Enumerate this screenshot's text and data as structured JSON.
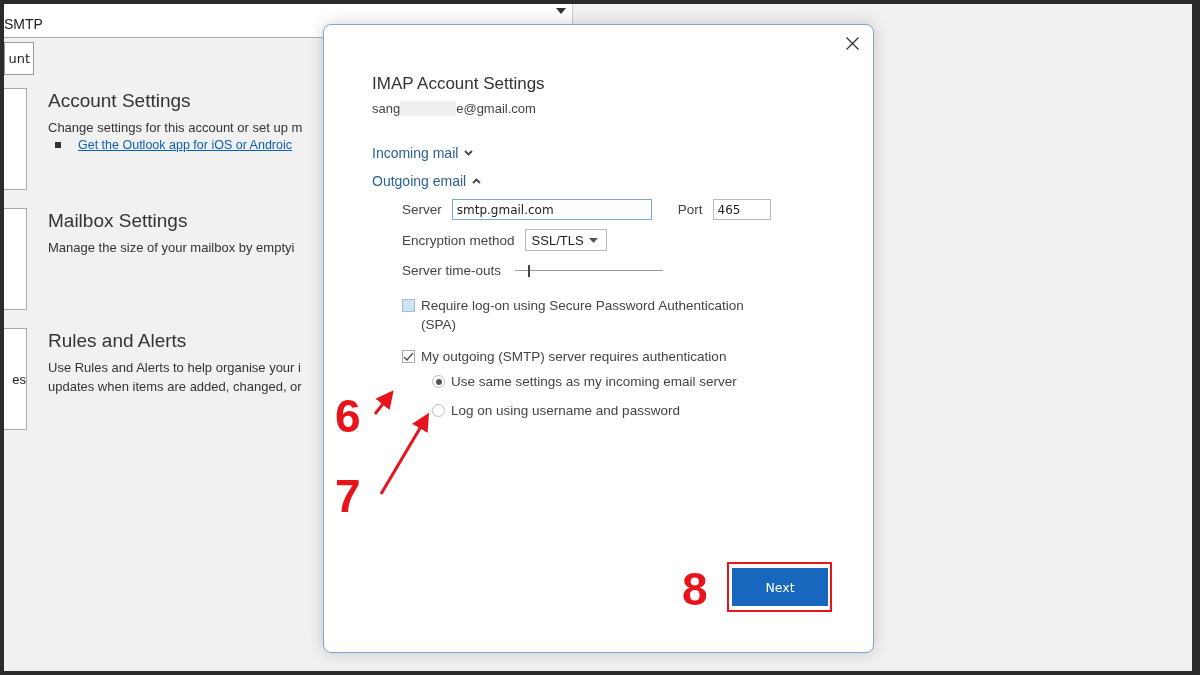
{
  "background": {
    "account_type": "SMTP",
    "button": "unt",
    "sections": [
      {
        "title": "Account Settings",
        "description": "Change settings for this account or set up m",
        "link": "Get the Outlook app for iOS or Androic"
      },
      {
        "title": "Mailbox Settings",
        "description": "Manage the size of your mailbox by emptyi"
      },
      {
        "side_text": "es",
        "title": "Rules and Alerts",
        "description": "Use Rules and Alerts to help organise your i",
        "description_2": "updates when items are added, changed, or"
      }
    ]
  },
  "dialog": {
    "title": "IMAP Account Settings",
    "email_start": "sang",
    "email_end": "e@gmail.com",
    "sections": [
      {
        "label": "Incoming mail",
        "expanded": false
      },
      {
        "label": "Outgoing email",
        "expanded": true
      }
    ],
    "server_label": "Server",
    "server": "smtp.gmail.com",
    "port_label": "Port",
    "port": "465",
    "encryption_label": "Encryption method",
    "encryption": "SSL/TLS",
    "timeouts_label": "Server time-outs",
    "timeouts": {
      "level": 0.09
    },
    "spa": {
      "label": "Require log-on using Secure Password Authentication (SPA)",
      "checked": false
    },
    "auth": {
      "label": "My outgoing (SMTP) server requires authentication",
      "checked": true
    },
    "auth_options": [
      {
        "label": "Use same settings as my incoming email server",
        "selected": true
      },
      {
        "label": "Log on using username and password",
        "selected": false
      }
    ],
    "next": "Next"
  },
  "annotations": [
    {
      "label": "6"
    },
    {
      "label": "7"
    },
    {
      "label": "8"
    }
  ]
}
